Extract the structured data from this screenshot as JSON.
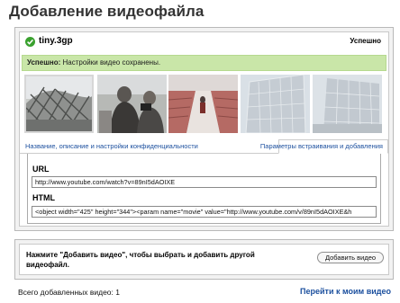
{
  "page_title": "Добавление видеофайла",
  "file": {
    "name": "tiny.3gp",
    "status": "Успешно",
    "status_icon": "check-circle-icon",
    "status_color": "#3aa12f"
  },
  "success_message": {
    "label": "Успешно:",
    "text": "Настройки видео сохранены.",
    "color": "#c9e6a8"
  },
  "thumbnails": [
    {
      "name": "thumbnail-stadium-lattice",
      "selected": true
    },
    {
      "name": "thumbnail-crowd-photographers",
      "selected": false
    },
    {
      "name": "thumbnail-red-seats",
      "selected": false
    },
    {
      "name": "thumbnail-water-cube",
      "selected": false
    },
    {
      "name": "thumbnail-water-cube-angle",
      "selected": false
    }
  ],
  "tabs": {
    "details": "Название, описание и настройки конфиденциальности",
    "embed": "Параметры встраивания и добавления"
  },
  "embed": {
    "url_label": "URL",
    "url_value": "http://www.youtube.com/watch?v=89nI5dAOIXE",
    "html_label": "HTML",
    "html_value": "<object width=\"425\" height=\"344\"><param name=\"movie\" value=\"http://www.youtube.com/v/89nI5dAOIXE&h"
  },
  "add_more": {
    "text": "Нажмите \"Добавить видео\", чтобы выбрать и добавить другой видеофайл.",
    "button": "Добавить видео"
  },
  "footer": {
    "count_text": "Всего добавленных видео: 1",
    "link": "Перейти к моим видео"
  },
  "colors": {
    "link": "#1b4f9e",
    "success_green": "#3aa12f"
  }
}
